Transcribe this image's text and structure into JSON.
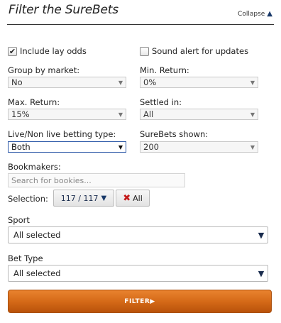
{
  "header": {
    "title": "Filter the SureBets",
    "collapse_label": "Collapse"
  },
  "options": {
    "include_lay_odds": {
      "label": "Include lay odds",
      "checked": true
    },
    "sound_alert": {
      "label": "Sound alert for updates",
      "checked": false
    }
  },
  "fields": {
    "group_by_market": {
      "label": "Group by market:",
      "value": "No"
    },
    "min_return": {
      "label": "Min. Return:",
      "value": "0%"
    },
    "max_return": {
      "label": "Max. Return:",
      "value": "15%"
    },
    "settled_in": {
      "label": "Settled in:",
      "value": "All"
    },
    "live_type": {
      "label": "Live/Non live betting type:",
      "value": "Both"
    },
    "surebets_shown": {
      "label": "SureBets shown:",
      "value": "200"
    }
  },
  "bookmakers": {
    "label": "Bookmakers:",
    "search_placeholder": "Search for bookies...",
    "selection_label": "Selection:",
    "selection_count": "117 / 117",
    "all_label": "All"
  },
  "sport": {
    "label": "Sport",
    "value": "All selected"
  },
  "bet_type": {
    "label": "Bet Type",
    "value": "All selected"
  },
  "filter_button": {
    "label": "FILTER▶"
  },
  "colors": {
    "filter_button": "#d56a18",
    "accent_border": "#2e5aa8",
    "clear_icon": "#c41a1a"
  }
}
